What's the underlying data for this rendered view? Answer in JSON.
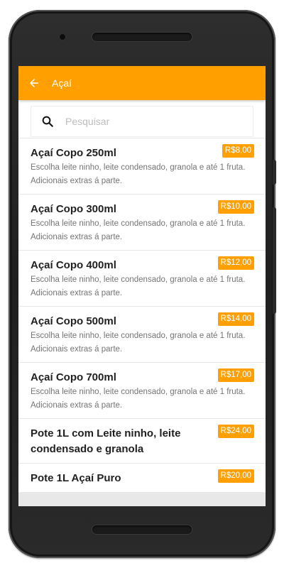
{
  "appbar": {
    "title": "Açaí",
    "back_icon": "arrow-back-icon"
  },
  "search": {
    "placeholder": "Pesquisar",
    "value": "",
    "icon": "search-icon"
  },
  "colors": {
    "accent": "#ffa000",
    "title_text": "#212121",
    "desc_text": "#757575"
  },
  "items": [
    {
      "name": "Açaí Copo 250ml",
      "price": "R$8,00",
      "description": "Escolha leite ninho, leite condensado, granola e até 1 fruta. Adicionais extras á parte."
    },
    {
      "name": "Açaí Copo 300ml",
      "price": "R$10,00",
      "description": "Escolha leite ninho, leite condensado, granola e até 1 fruta. Adicionais extras á parte."
    },
    {
      "name": "Açaí Copo 400ml",
      "price": "R$12,00",
      "description": "Escolha leite ninho, leite condensado, granola e até 1 fruta. Adicionais extras á parte."
    },
    {
      "name": "Açaí Copo 500ml",
      "price": "R$14,00",
      "description": "Escolha leite ninho, leite condensado, granola e até 1 fruta. Adicionais extras á parte."
    },
    {
      "name": "Açaí Copo 700ml",
      "price": "R$17,00",
      "description": "Escolha leite ninho, leite condensado, granola e até 1 fruta. Adicionais extras á parte."
    },
    {
      "name": "Pote 1L com Leite ninho, leite condensado e granola",
      "price": "R$24,00",
      "description": ""
    },
    {
      "name": "Pote 1L Açaí Puro",
      "price": "R$20,00",
      "description": ""
    }
  ]
}
